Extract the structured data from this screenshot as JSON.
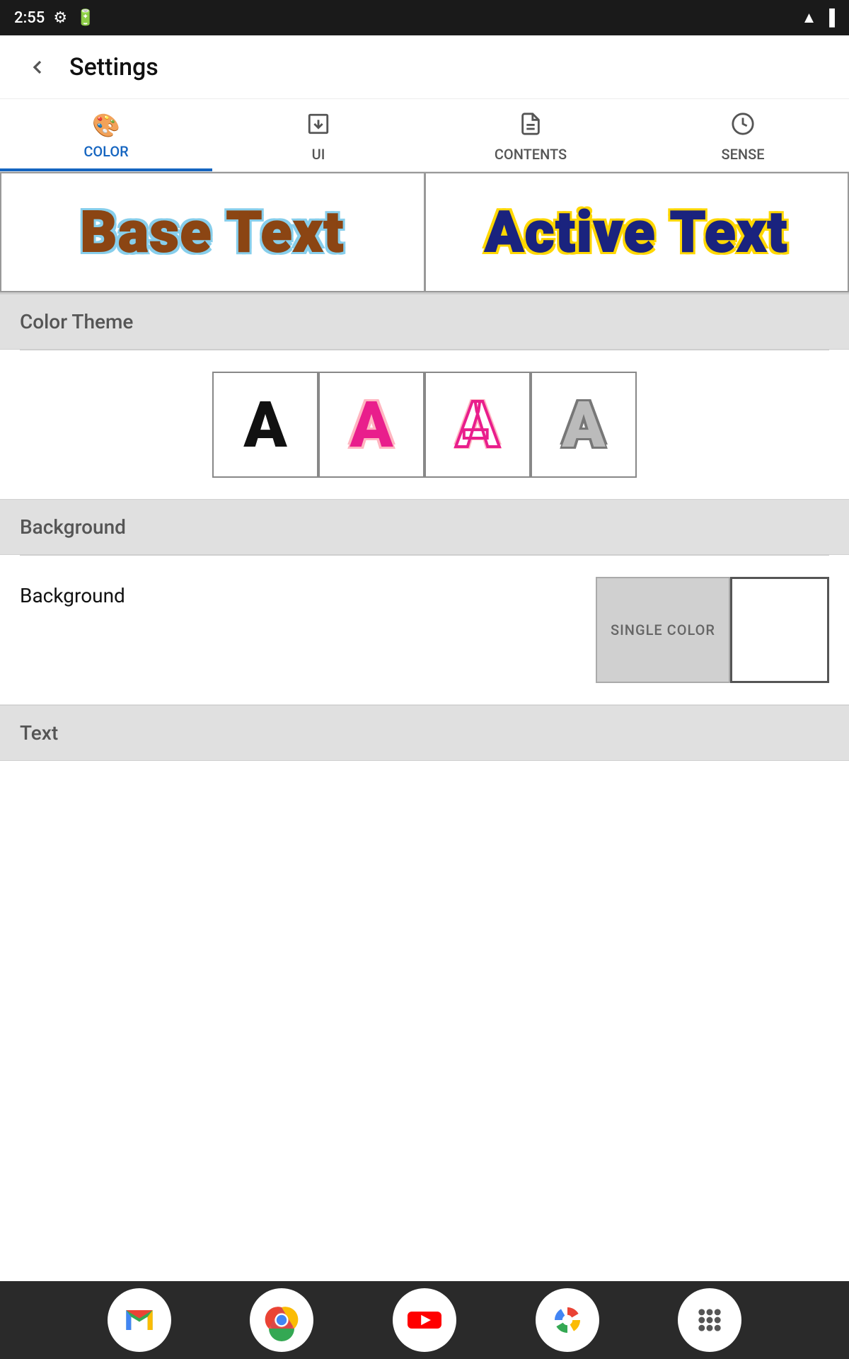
{
  "statusBar": {
    "time": "2:55",
    "icons": [
      "settings-icon",
      "sim-icon",
      "wifi-icon",
      "signal-icon"
    ]
  },
  "appBar": {
    "title": "Settings",
    "backLabel": "←"
  },
  "tabs": [
    {
      "id": "color",
      "label": "COLOR",
      "icon": "🎨",
      "active": true
    },
    {
      "id": "ui",
      "label": "UI",
      "icon": "📥",
      "active": false
    },
    {
      "id": "contents",
      "label": "CONTENTS",
      "icon": "📄",
      "active": false
    },
    {
      "id": "sense",
      "label": "SENSE",
      "icon": "⏱",
      "active": false
    }
  ],
  "preview": {
    "baseText": "Base Text",
    "activeText": "Active Text"
  },
  "sections": {
    "colorTheme": {
      "header": "Color Theme",
      "options": [
        {
          "style": "plain",
          "letter": "A"
        },
        {
          "style": "pink",
          "letter": "A"
        },
        {
          "style": "pink-outline",
          "letter": "A"
        },
        {
          "style": "gray",
          "letter": "A"
        }
      ]
    },
    "background": {
      "header": "Background",
      "rowLabel": "Background",
      "singleColorLabel": "SINGLE COLOR",
      "whiteOption": ""
    },
    "text": {
      "header": "Text"
    }
  },
  "bottomNav": {
    "apps": [
      {
        "name": "gmail",
        "label": "Gmail"
      },
      {
        "name": "chrome",
        "label": "Chrome"
      },
      {
        "name": "youtube",
        "label": "YouTube"
      },
      {
        "name": "photos",
        "label": "Photos"
      },
      {
        "name": "apps",
        "label": "Apps"
      }
    ]
  }
}
